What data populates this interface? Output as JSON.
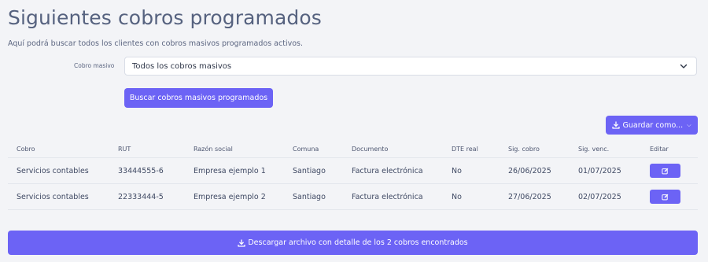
{
  "header": {
    "title": "Siguientes cobros programados",
    "subtitle": "Aquí podrá buscar todos los clientes con cobros masivos programados activos."
  },
  "filter": {
    "label": "Cobro masivo",
    "selected": "Todos los cobros masivos",
    "search_button": "Buscar cobros masivos programados"
  },
  "toolbar": {
    "save_label": "Guardar como...",
    "save_icon": "download-icon"
  },
  "table": {
    "columns": [
      "Cobro",
      "RUT",
      "Razón social",
      "Comuna",
      "Documento",
      "DTE real",
      "Sig. cobro",
      "Sig. venc.",
      "Editar"
    ],
    "rows": [
      [
        "Servicios contables",
        "33444555-6",
        "Empresa ejemplo 1",
        "Santiago",
        "Factura electrónica",
        "No",
        "26/06/2025",
        "01/07/2025"
      ],
      [
        "Servicios contables",
        "22333444-5",
        "Empresa ejemplo 2",
        "Santiago",
        "Factura electrónica",
        "No",
        "27/06/2025",
        "02/07/2025"
      ]
    ],
    "edit_icon": "edit-icon"
  },
  "footer": {
    "download_label": "Descargar archivo con detalle de los 2 cobros encontrados"
  },
  "colors": {
    "accent": "#6c63f5",
    "background": "#f3f4f7",
    "title": "#56627f"
  }
}
